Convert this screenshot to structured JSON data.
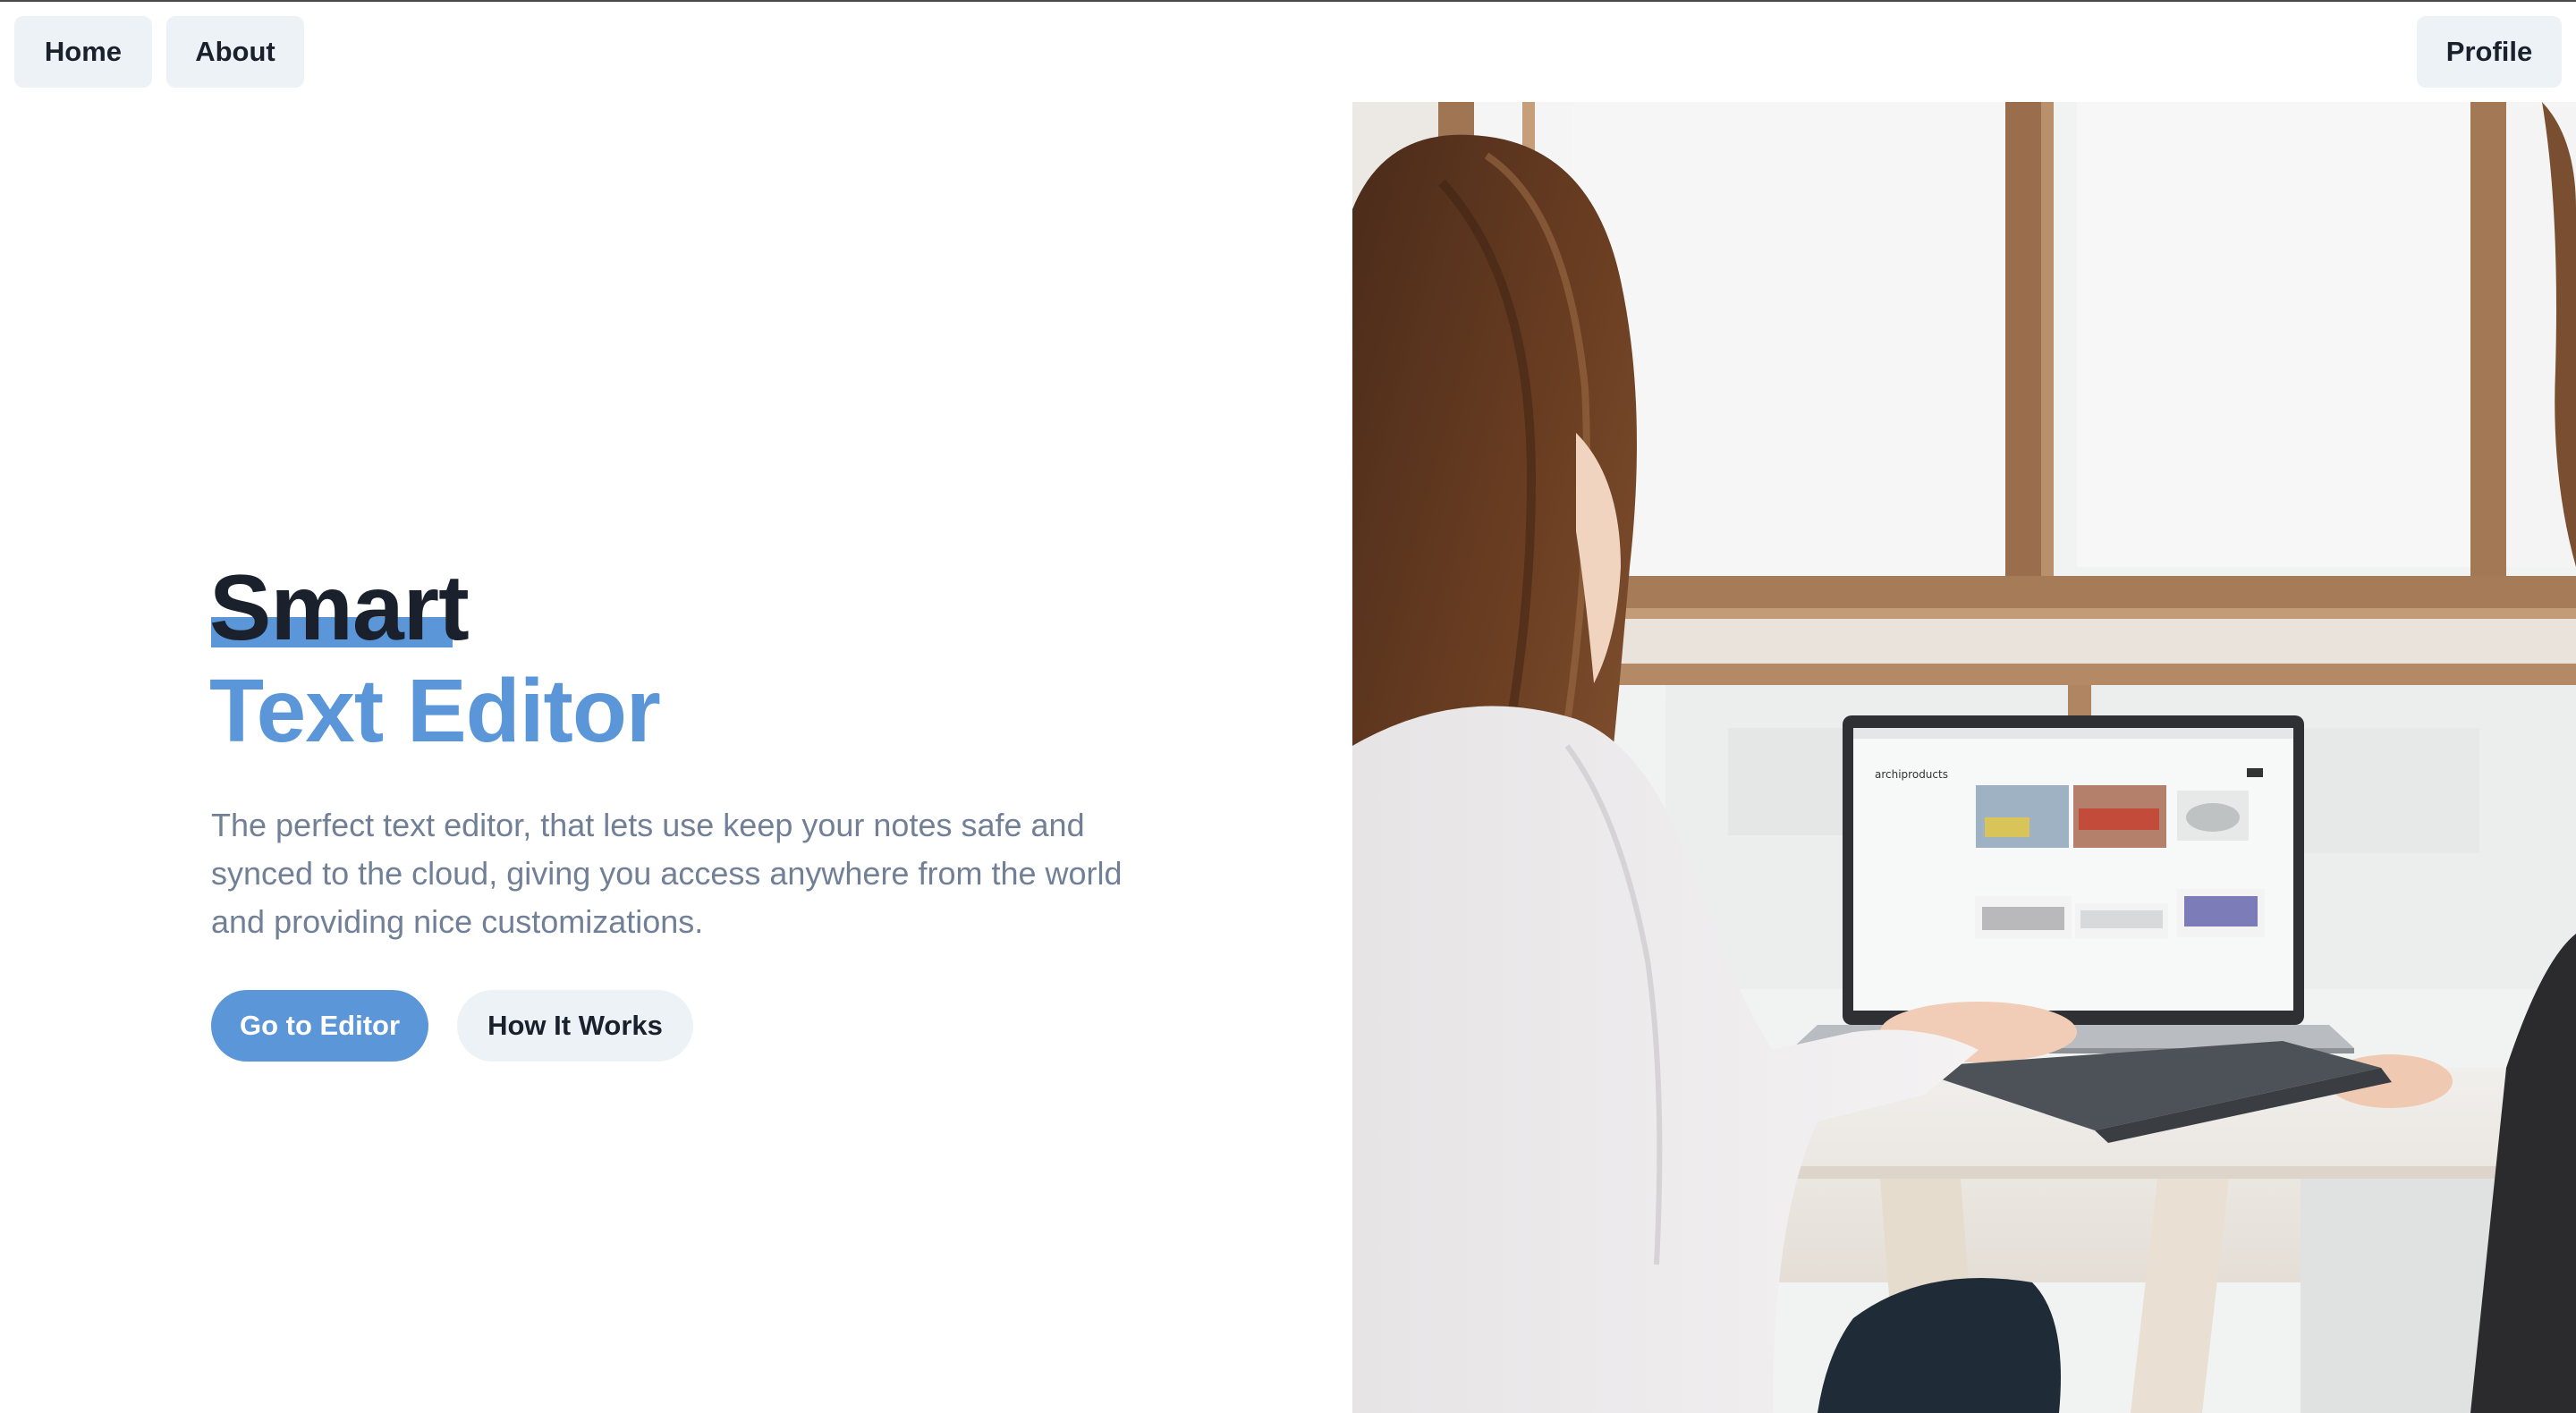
{
  "nav": {
    "home_label": "Home",
    "about_label": "About",
    "profile_label": "Profile"
  },
  "hero": {
    "title_line1": "Smart",
    "title_line2": "Text Editor",
    "description": "The perfect text editor, that lets use keep your notes safe and synced to the cloud, giving you access anywhere from the world and providing nice customizations.",
    "primary_cta": "Go to Editor",
    "secondary_cta": "How It Works"
  },
  "photo": {
    "laptop_screen_brand": "archiproducts"
  },
  "colors": {
    "accent": "#5a96d8",
    "heading": "#1a202c",
    "body_text": "#718096",
    "button_bg": "#edf2f7"
  }
}
